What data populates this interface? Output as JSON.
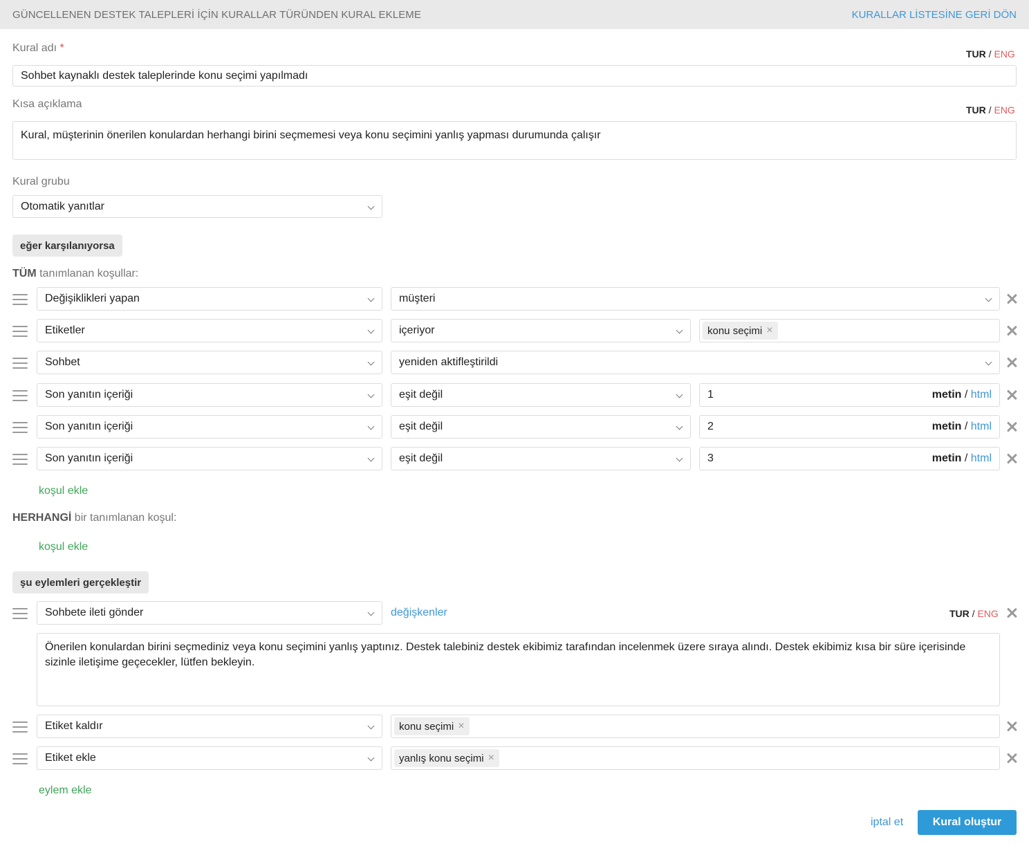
{
  "header": {
    "title": "GÜNCELLENEN DESTEK TALEPLERİ İÇİN KURALLAR TÜRÜNDEN KURAL EKLEME",
    "back_link": "KURALLAR LİSTESİNE GERİ DÖN"
  },
  "lang_switch": {
    "tur": "TUR",
    "sep": "/",
    "eng": "ENG"
  },
  "rule_name": {
    "label": "Kural adı",
    "required_mark": "*",
    "value": "Sohbet kaynaklı destek taleplerinde konu seçimi yapılmadı"
  },
  "short_desc": {
    "label": "Kısa açıklama",
    "value": "Kural, müşterinin önerilen konulardan herhangi birini seçmemesi veya konu seçimini yanlış yapması durumunda çalışır"
  },
  "rule_group": {
    "label": "Kural grubu",
    "value": "Otomatik yanıtlar"
  },
  "conditions": {
    "section_label": "eğer karşılanıyorsa",
    "all_prefix": "TÜM",
    "all_suffix": " tanımlanan koşullar:",
    "rows": [
      {
        "field": "Değişiklikleri yapan",
        "operator": "müşteri"
      },
      {
        "field": "Etiketler",
        "operator": "içeriyor",
        "tag": "konu seçimi"
      },
      {
        "field": "Sohbet",
        "operator": "yeniden aktifleştirildi"
      },
      {
        "field": "Son yanıtın içeriği",
        "operator": "eşit değil",
        "value": "1"
      },
      {
        "field": "Son yanıtın içeriği",
        "operator": "eşit değil",
        "value": "2"
      },
      {
        "field": "Son yanıtın içeriği",
        "operator": "eşit değil",
        "value": "3"
      }
    ],
    "format": {
      "metin": "metin",
      "sep": "/",
      "html": "html"
    },
    "add_condition": "koşul ekle",
    "any_prefix": "HERHANGİ",
    "any_suffix": " bir tanımlanan koşul:",
    "add_condition_any": "koşul ekle"
  },
  "actions": {
    "section_label": "şu eylemleri gerçekleştir",
    "rows": [
      {
        "type": "Sohbete ileti gönder",
        "variables_link": "değişkenler",
        "message": "Önerilen konulardan birini seçmediniz veya konu seçimini yanlış yaptınız. Destek talebiniz destek ekibimiz tarafından incelenmek üzere sıraya alındı. Destek ekibimiz kısa bir süre içerisinde sizinle iletişime geçecekler, lütfen bekleyin."
      },
      {
        "type": "Etiket kaldır",
        "tag": "konu seçimi"
      },
      {
        "type": "Etiket ekle",
        "tag": "yanlış konu seçimi"
      }
    ],
    "add_action": "eylem ekle"
  },
  "footer": {
    "cancel": "iptal et",
    "submit": "Kural oluştur"
  },
  "colors": {
    "accent_blue": "#2e9ad8",
    "link_blue": "#3f97d5",
    "link_green": "#3ea658",
    "eng_red": "#e35b5b"
  },
  "icons": {
    "drag": "drag-handle-icon",
    "remove": "close-icon",
    "select": "chevron-down-icon",
    "tag_remove": "tag-remove-icon"
  }
}
